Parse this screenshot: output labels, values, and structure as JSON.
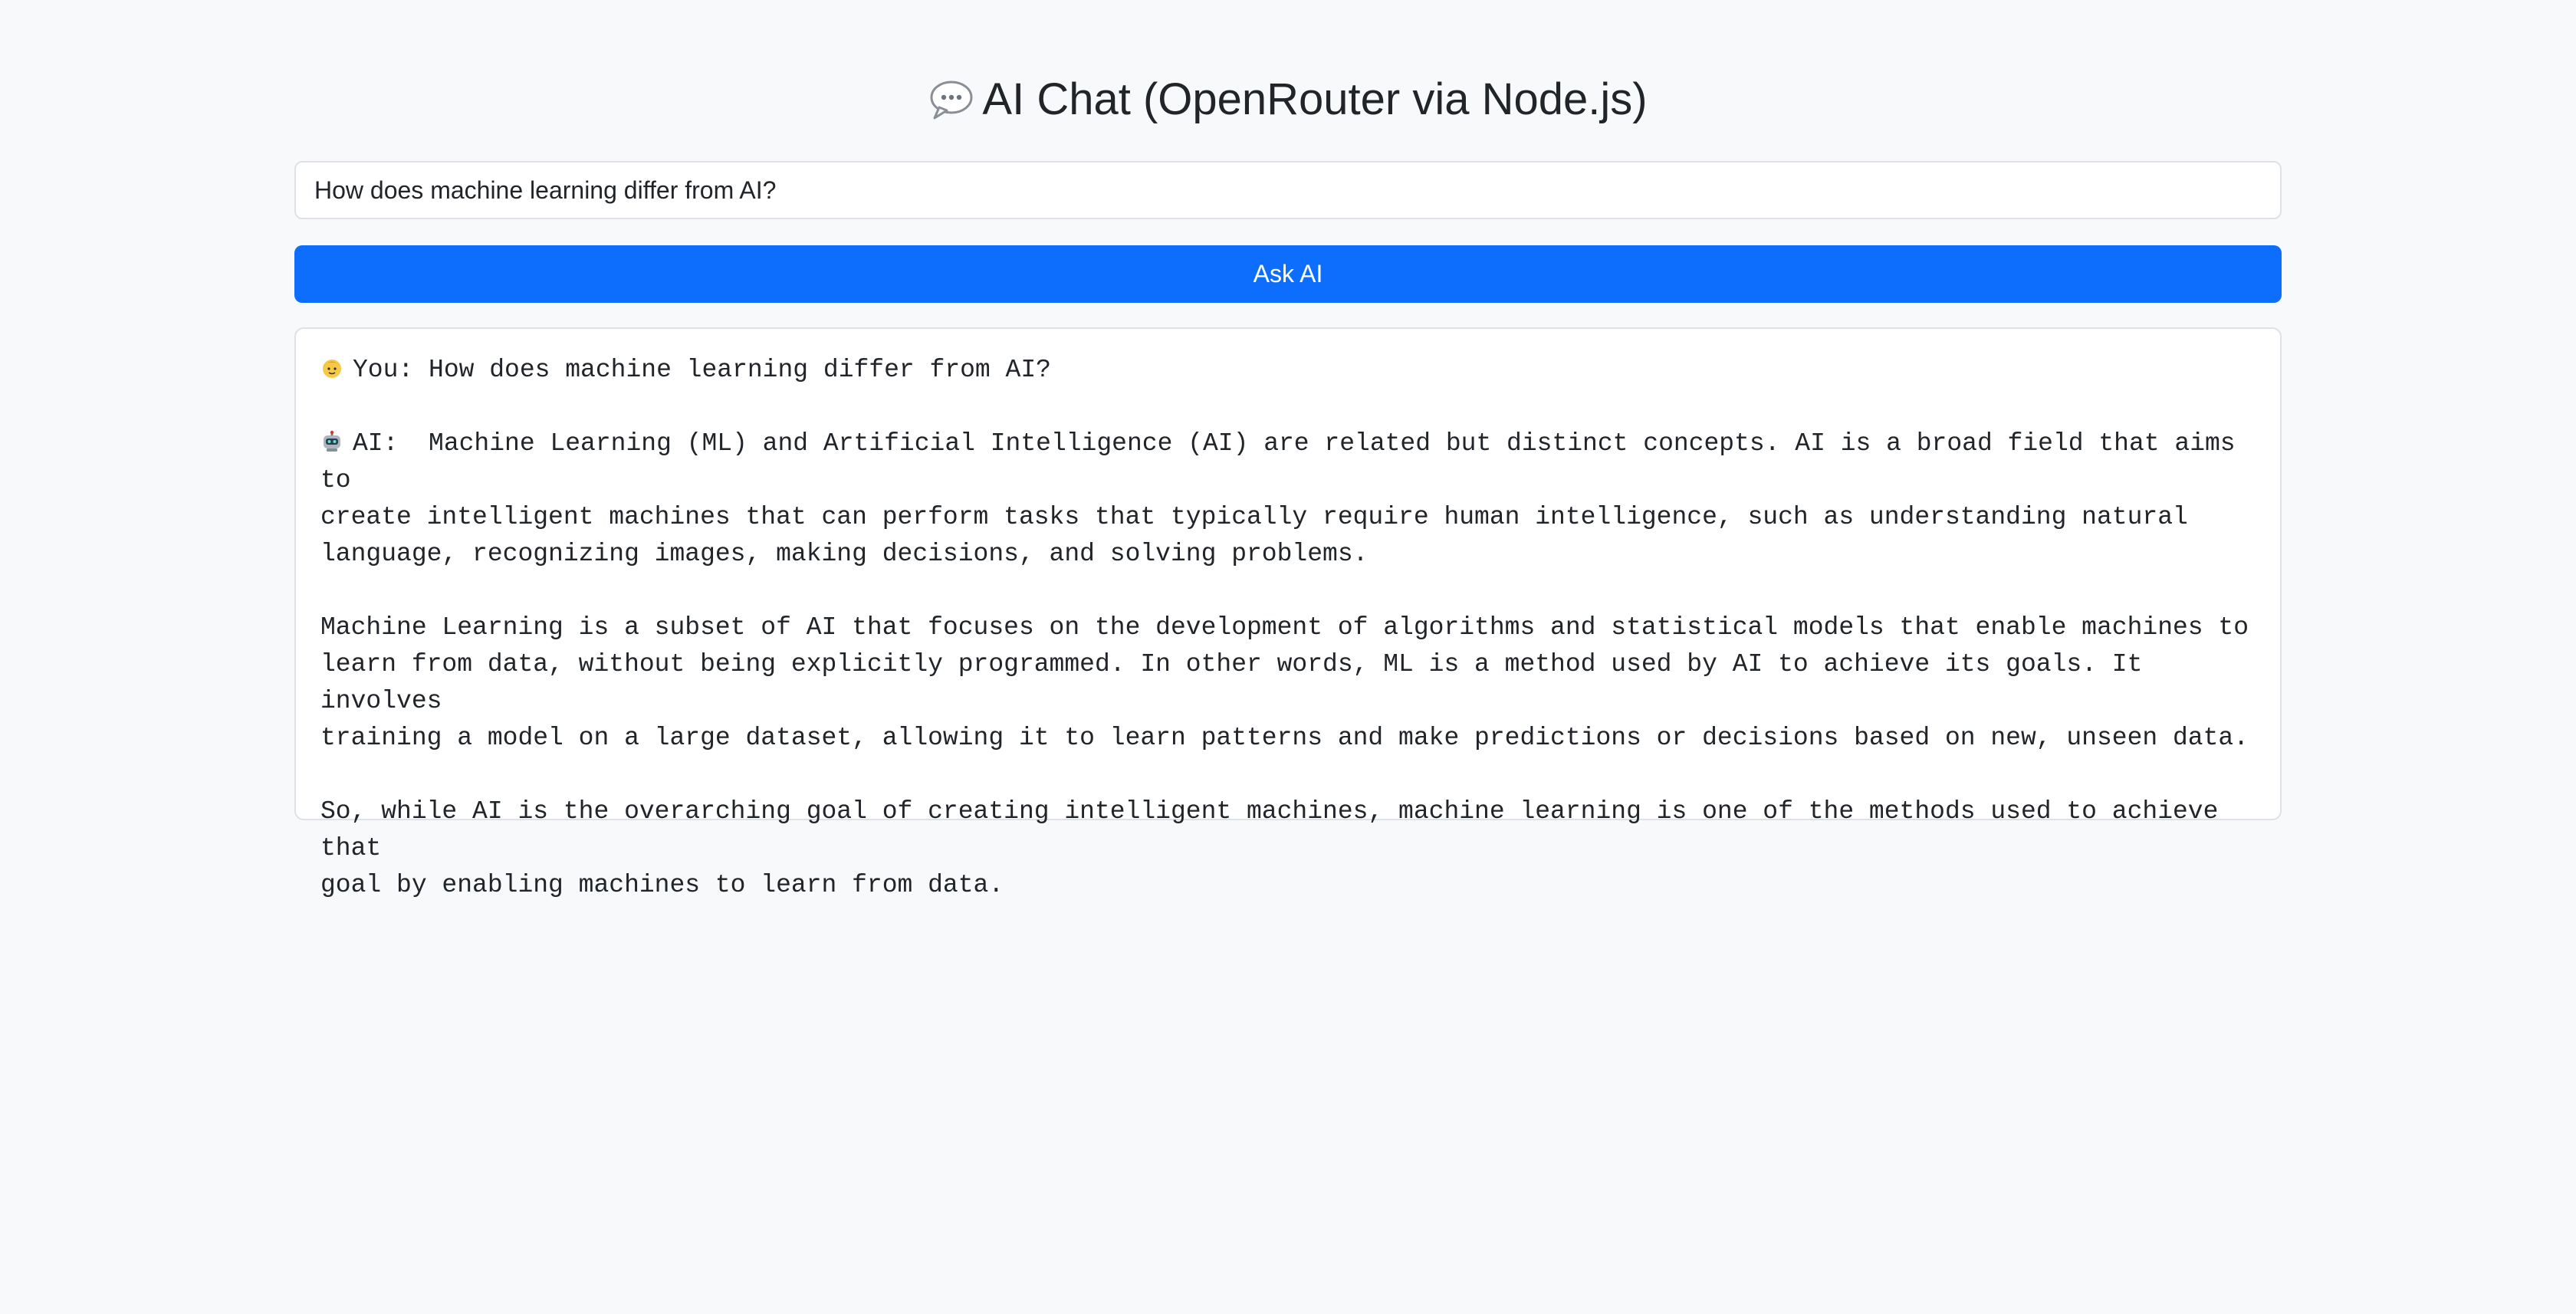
{
  "header": {
    "title": "AI Chat (OpenRouter via Node.js)",
    "icon": "speech-bubble-icon"
  },
  "input": {
    "value": "How does machine learning differ from AI?"
  },
  "button": {
    "label": "Ask AI",
    "color": "#0d6efd"
  },
  "conversation": {
    "user_icon": "person-face-icon",
    "user_line": "You: How does machine learning differ from AI?",
    "ai_icon": "robot-icon",
    "ai_prefix": "AI:  Machine Learning (ML) and Artificial Intelligence (AI) are related but distinct concepts. AI is a broad field that aims to",
    "ai_line2": "create intelligent machines that can perform tasks that typically require human intelligence, such as understanding natural",
    "ai_line3": "language, recognizing images, making decisions, and solving problems.",
    "ai_p2_line1": "Machine Learning is a subset of AI that focuses on the development of algorithms and statistical models that enable machines to",
    "ai_p2_line2": "learn from data, without being explicitly programmed. In other words, ML is a method used by AI to achieve its goals. It involves",
    "ai_p2_line3": "training a model on a large dataset, allowing it to learn patterns and make predictions or decisions based on new, unseen data.",
    "ai_p3_line1": "So, while AI is the overarching goal of creating intelligent machines, machine learning is one of the methods used to achieve that",
    "ai_p3_line2": "goal by enabling machines to learn from data."
  }
}
